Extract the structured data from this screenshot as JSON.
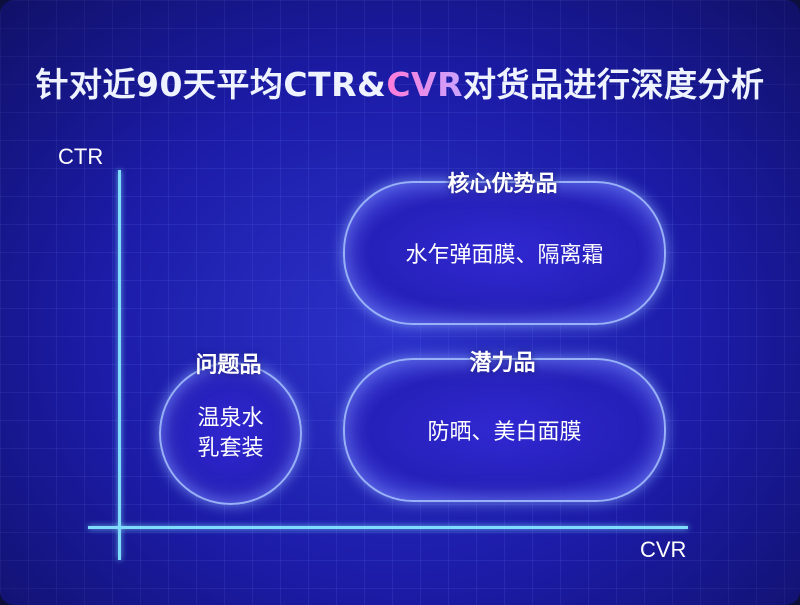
{
  "title": {
    "part1": "针对近90天平均CTR&",
    "highlight": "CVR",
    "part2": "对货品进行深度分析",
    "highlight_color": "#ff7bd8"
  },
  "axes": {
    "y_label": "CTR",
    "x_label": "CVR"
  },
  "quadrants": {
    "core": {
      "title": "核心优势品",
      "items": "水乍弹面膜、隔离霜"
    },
    "potential": {
      "title": "潜力品",
      "items": "防晒、美白面膜"
    },
    "problem": {
      "title": "问题品",
      "items_line1": "温泉水",
      "items_line2": "乳套装"
    }
  },
  "colors": {
    "background": "#1a1aa8",
    "axis": "#7fdcff",
    "text": "#ffffff"
  }
}
